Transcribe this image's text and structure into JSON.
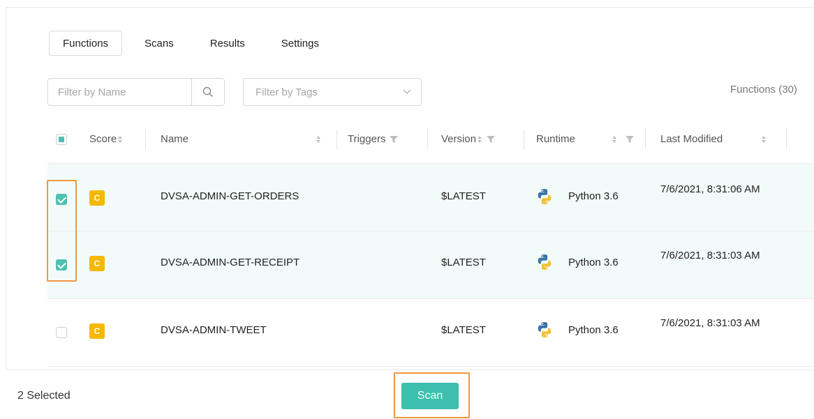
{
  "tabs": [
    {
      "label": "Functions",
      "active": true
    },
    {
      "label": "Scans",
      "active": false
    },
    {
      "label": "Results",
      "active": false
    },
    {
      "label": "Settings",
      "active": false
    }
  ],
  "filters": {
    "name_placeholder": "Filter by Name",
    "tags_placeholder": "Filter by Tags"
  },
  "functions_count_label": "Functions (30)",
  "table": {
    "headers": {
      "score": "Score",
      "name": "Name",
      "triggers": "Triggers",
      "version": "Version",
      "runtime": "Runtime",
      "last_modified": "Last Modified"
    },
    "rows": [
      {
        "checked": true,
        "score": "C",
        "name": "DVSA-ADMIN-GET-ORDERS",
        "version": "$LATEST",
        "runtime": "Python 3.6",
        "last_modified": "7/6/2021, 8:31:06 AM"
      },
      {
        "checked": true,
        "score": "C",
        "name": "DVSA-ADMIN-GET-RECEIPT",
        "version": "$LATEST",
        "runtime": "Python 3.6",
        "last_modified": "7/6/2021, 8:31:03 AM"
      },
      {
        "checked": false,
        "score": "C",
        "name": "DVSA-ADMIN-TWEET",
        "version": "$LATEST",
        "runtime": "Python 3.6",
        "last_modified": "7/6/2021, 8:31:03 AM"
      }
    ]
  },
  "footer": {
    "selected_label": "2 Selected",
    "scan_label": "Scan"
  },
  "colors": {
    "accent": "#3cbfad",
    "badge": "#f5b800",
    "highlight": "#f0963c",
    "selected_row": "#f2fbf9"
  },
  "icons": {
    "search": "search-icon",
    "chevron": "chevron-down-icon",
    "sort": "sort-icon",
    "filter": "filter-icon",
    "runtime": "python-icon"
  }
}
